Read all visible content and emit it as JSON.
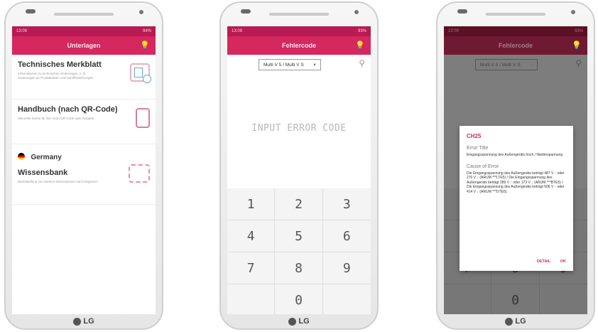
{
  "brand": {
    "accent": "#d4285f",
    "logo_text": "LG"
  },
  "screen1": {
    "status": {
      "time": "13:09",
      "right": "94%"
    },
    "title": "Unterlagen",
    "cards": [
      {
        "title": "Technisches Merkblatt",
        "desc": "Informationen zu technischen Änderungen, z. B. Änderungen an Produktdaten und Veröffentlichungen"
      },
      {
        "title": "Handbuch (nach QR-Code)",
        "desc": "Manuelle Suche für den Scan QR-Code oder Eingabe"
      },
      {
        "country": "Germany",
        "title": "Wissensbank",
        "desc": "Bereitstellung von Service-Informationen nach Regionen"
      }
    ]
  },
  "screen2": {
    "status": {
      "time": "13:09",
      "right": "93%"
    },
    "title": "Fehlercode",
    "dropdown": "Multi V 5 / Multi V S",
    "input_placeholder": "INPUT ERROR CODE",
    "keys": [
      "1",
      "2",
      "3",
      "4",
      "5",
      "6",
      "7",
      "8",
      "9",
      "",
      "0",
      ""
    ]
  },
  "screen3": {
    "status": {
      "time": "13:09",
      "right": "93%"
    },
    "title": "Fehlercode",
    "dropdown": "Multi V 5 / Multi V S",
    "keys": [
      "1",
      "2",
      "3",
      "4",
      "5",
      "6",
      "7",
      "8",
      "9",
      "",
      "0",
      ""
    ],
    "dialog": {
      "code": "CH25",
      "error_title_label": "Error Title",
      "error_title": "Eingangsspannung des Außengeräts hoch / Niederspannung",
      "cause_label": "Cause of Error",
      "cause": "Die Eingangsspannung des Außengeräts beträgt 487 V ↑ oder 270 V ↓ (ARUM ***LTE5) / Die Eingangsspannung des Außengeräts beträgt 289 V ↑ oder 173 V ↓ (ARUM ***BTE5) / Die Eingangsspannung des Außengeräts beträgt 506 V ↑ oder 414 V ↓ (ARUM ***DTE5).",
      "detail_button": "DETAIL",
      "ok_button": "OK"
    }
  }
}
